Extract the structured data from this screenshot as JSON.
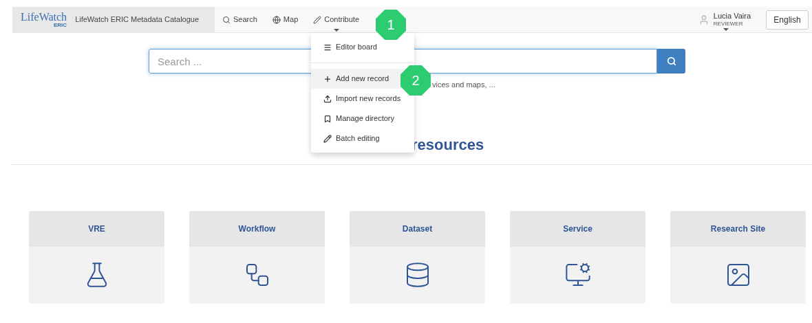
{
  "header": {
    "logo": {
      "line1": "LifeWatch",
      "line2": "ERIC"
    },
    "site_title": "LifeWatch ERIC Metadata Catalogue",
    "nav": [
      {
        "label": "Search",
        "kind": "search",
        "open": false
      },
      {
        "label": "Map",
        "kind": "map",
        "open": false
      },
      {
        "label": "Contribute",
        "kind": "contribute",
        "open": true
      }
    ],
    "user": {
      "name": "Lucia Vaira",
      "role": "REVIEWER"
    },
    "language": "English"
  },
  "contribute_menu": [
    {
      "label": "Editor board",
      "kind": "list",
      "highlighted": false
    },
    {
      "label": "Add new record",
      "kind": "plus",
      "highlighted": true
    },
    {
      "label": "Import new records",
      "kind": "upload",
      "highlighted": false
    },
    {
      "label": "Manage directory",
      "kind": "bookmark",
      "highlighted": false
    },
    {
      "label": "Batch editing",
      "kind": "pencil",
      "highlighted": false
    }
  ],
  "search": {
    "placeholder": "Search ...",
    "hint": "vices and maps, ..."
  },
  "heading": "resources",
  "cards": [
    {
      "title": "VRE",
      "kind": "vre"
    },
    {
      "title": "Workflow",
      "kind": "workflow"
    },
    {
      "title": "Dataset",
      "kind": "dataset"
    },
    {
      "title": "Service",
      "kind": "service"
    },
    {
      "title": "Research Site",
      "kind": "site"
    }
  ],
  "callouts": [
    {
      "label": "1"
    },
    {
      "label": "2"
    }
  ]
}
